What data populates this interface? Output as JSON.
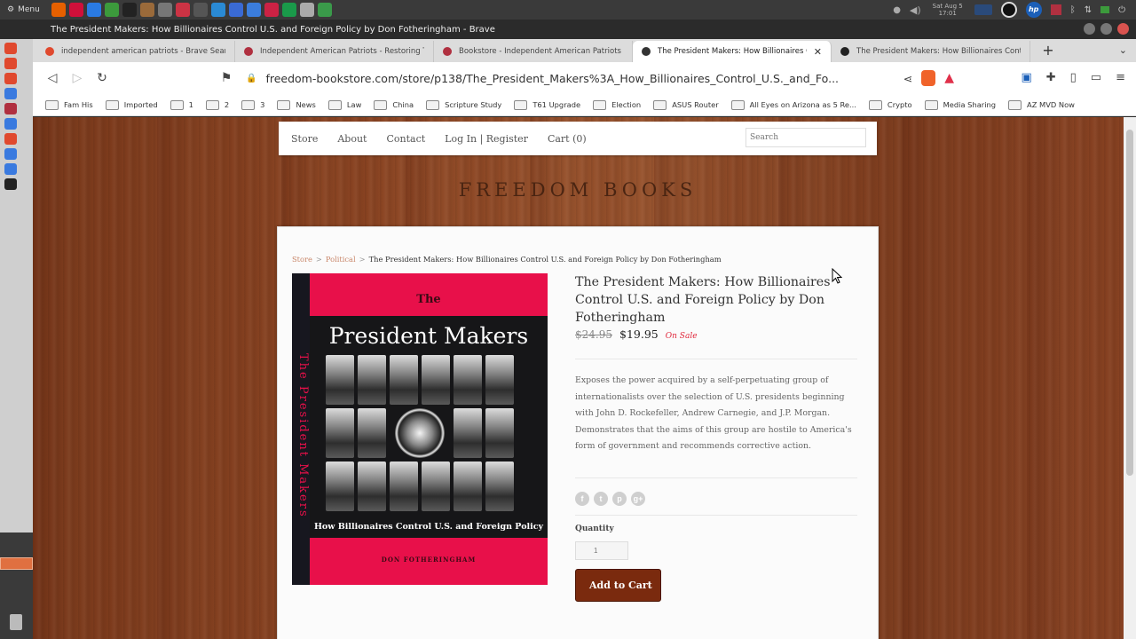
{
  "desktop": {
    "menu_label": "Menu",
    "clock_line1": "Sat Aug 5",
    "clock_line2": "17:01",
    "launcher_colors": [
      "#e66000",
      "#d0103a",
      "#2a7ae2",
      "#3c9a3c",
      "#222222",
      "#9a6a3a",
      "#777777",
      "#cc3344",
      "#555555",
      "#2a8ad4",
      "#3a6ad4",
      "#3b7ddd",
      "#cc2244",
      "#1a9a4a",
      "#aaaaaa",
      "#3a9a4a"
    ],
    "dock_colors": [
      "#e0492e",
      "#e0492e",
      "#e0492e",
      "#3a7adf",
      "#b03040",
      "#3a7adf",
      "#e0492e",
      "#3a7adf",
      "#3a7adf",
      "#222222"
    ]
  },
  "window": {
    "title": "The President Makers: How Billionaires Control U.S. and Foreign Policy by Don Fotheringham - Brave"
  },
  "tabs": [
    {
      "label": "independent american patriots - Brave Search",
      "fav_color": "#e0492e",
      "active": false
    },
    {
      "label": "Independent American Patriots - Restoring The Re",
      "fav_color": "#b03040",
      "active": false
    },
    {
      "label": "Bookstore - Independent American Patriots",
      "fav_color": "#b03040",
      "active": false
    },
    {
      "label": "The President Makers: How Billionaires Cont",
      "fav_color": "#333333",
      "active": true
    },
    {
      "label": "The President Makers: How Billionaires Control U.S.",
      "fav_color": "#222222",
      "active": false
    }
  ],
  "address_bar": {
    "url": "freedom-bookstore.com/store/p138/The_President_Makers%3A_How_Billionaires_Control_U.S._and_Fo..."
  },
  "bookmarks": [
    {
      "label": "Fam His"
    },
    {
      "label": "Imported"
    },
    {
      "label": "1"
    },
    {
      "label": "2"
    },
    {
      "label": "3"
    },
    {
      "label": "News"
    },
    {
      "label": "Law"
    },
    {
      "label": "China"
    },
    {
      "label": "Scripture Study"
    },
    {
      "label": "T61 Upgrade"
    },
    {
      "label": "Election"
    },
    {
      "label": "ASUS Router"
    },
    {
      "label": "All Eyes on Arizona as 5 Re..."
    },
    {
      "label": "Crypto"
    },
    {
      "label": "Media Sharing"
    },
    {
      "label": "AZ MVD Now"
    }
  ],
  "site": {
    "nav": {
      "store": "Store",
      "about": "About",
      "contact": "Contact",
      "login": "Log In | Register",
      "cart": "Cart (0)",
      "search_placeholder": "Search"
    },
    "title": "FREEDOM BOOKS",
    "breadcrumb": {
      "store": "Store",
      "category": "Political",
      "current": "The President Makers: How Billionaires Control U.S. and Foreign Policy by Don Fotheringham"
    },
    "cover": {
      "spine_text": "The President Makers",
      "the": "The",
      "title": "President Makers",
      "subtitle": "How Billionaires Control U.S. and Foreign Policy",
      "author": "DON FOTHERINGHAM"
    },
    "product": {
      "title": "The President Makers: How Billionaires Control U.S. and Foreign Policy by Don Fotheringham",
      "old_price": "$24.95",
      "price": "$19.95",
      "sale_label": "On Sale",
      "description": "Exposes the power acquired by a self-perpetuating group of internationalists over the selection of U.S. presidents beginning with John D. Rockefeller, Andrew Carnegie, and J.P. Morgan. Demonstrates that the aims of this group are hostile to America's form of government and recommends corrective action.",
      "share": {
        "facebook": "f",
        "twitter": "t",
        "pinterest": "p",
        "google": "g+"
      },
      "quantity_label": "Quantity",
      "quantity_value": "1",
      "add_to_cart": "Add to Cart"
    }
  }
}
